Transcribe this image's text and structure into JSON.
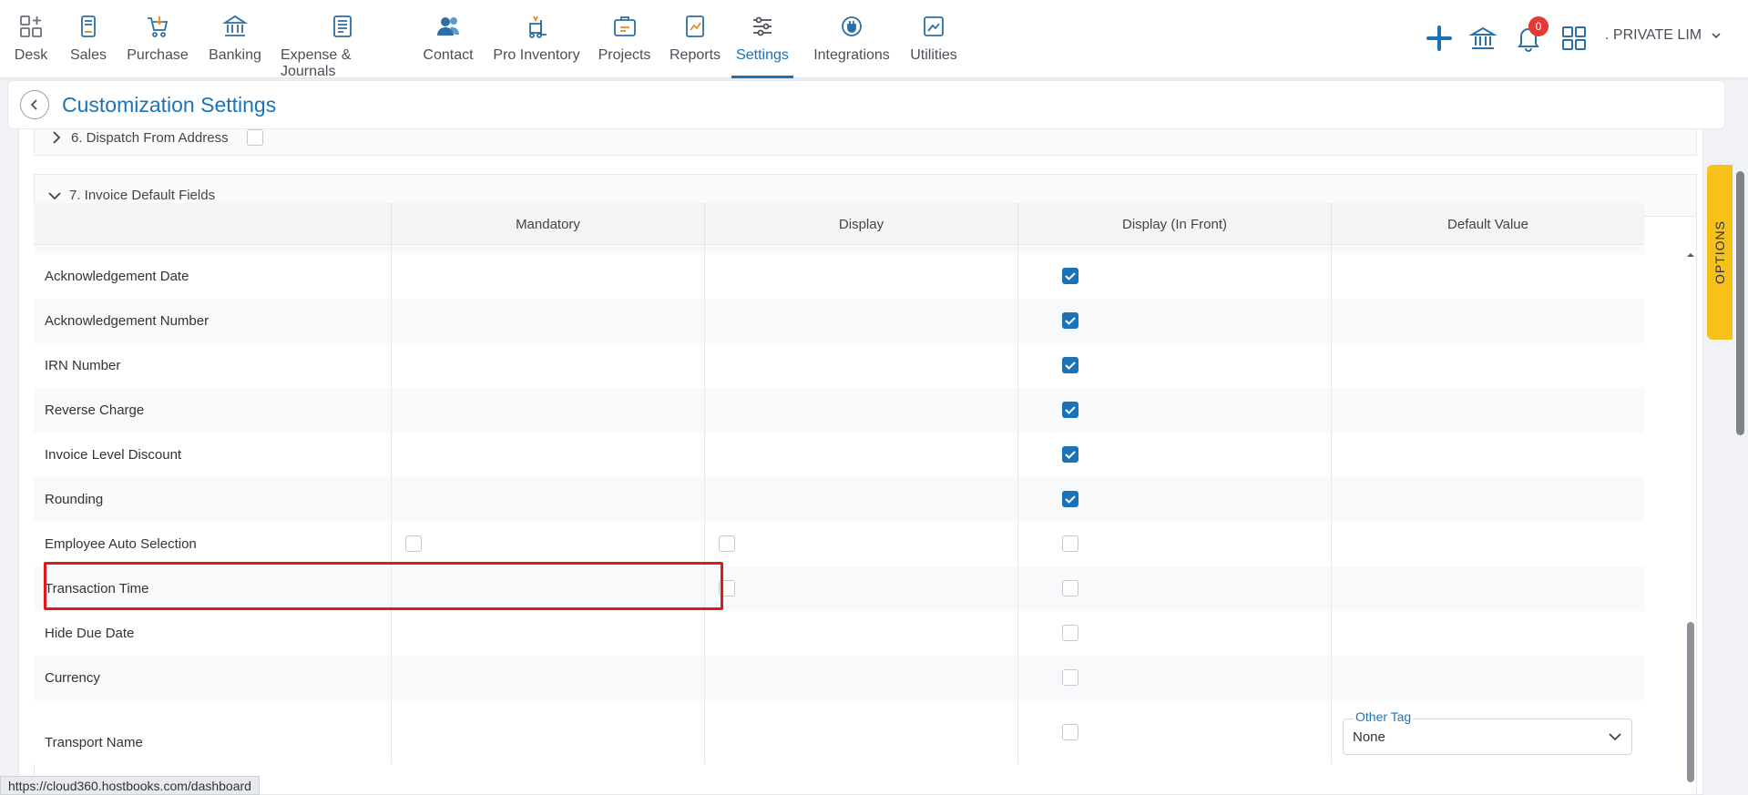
{
  "nav": {
    "items": [
      {
        "label": "Desk",
        "icon": "desk-icon"
      },
      {
        "label": "Sales",
        "icon": "sales-icon"
      },
      {
        "label": "Purchase",
        "icon": "cart-icon"
      },
      {
        "label": "Banking",
        "icon": "bank-icon"
      },
      {
        "label": "Expense & Journals",
        "icon": "journal-icon"
      },
      {
        "label": "Contact",
        "icon": "contacts-icon"
      },
      {
        "label": "Pro Inventory",
        "icon": "inventory-icon"
      },
      {
        "label": "Projects",
        "icon": "projects-icon"
      },
      {
        "label": "Reports",
        "icon": "reports-icon"
      },
      {
        "label": "Settings",
        "icon": "settings-sliders-icon"
      },
      {
        "label": "Integrations",
        "icon": "integrations-icon"
      },
      {
        "label": "Utilities",
        "icon": "utilities-icon"
      }
    ],
    "active": "Settings",
    "notification_count": "0",
    "company": ". PRIVATE LIM"
  },
  "page": {
    "title": "Customization Settings"
  },
  "sections": {
    "dispatch": "6. Dispatch From Address",
    "invoice_fields": "7. Invoice Default Fields"
  },
  "table": {
    "headers": [
      "Mandatory",
      "Display",
      "Display (In Front)",
      "Default Value"
    ],
    "rows": [
      {
        "name": "Acknowledgement Date"
      },
      {
        "name": "Acknowledgement Number"
      },
      {
        "name": "IRN Number"
      },
      {
        "name": "Reverse Charge"
      },
      {
        "name": "Invoice Level Discount"
      },
      {
        "name": "Rounding"
      },
      {
        "name": "Employee Auto Selection"
      },
      {
        "name": "Transaction Time"
      },
      {
        "name": "Hide Due Date"
      },
      {
        "name": "Currency"
      },
      {
        "name": "Transport Name"
      }
    ]
  },
  "other_tag": {
    "label": "Other Tag",
    "value": "None"
  },
  "options_tab": "OPTIONS",
  "status_url": "https://cloud360.hostbooks.com/dashboard",
  "colors": {
    "accent": "#1a73b8",
    "highlight": "#e01919",
    "options_tab": "#f6c21a",
    "badge": "#e53935"
  }
}
